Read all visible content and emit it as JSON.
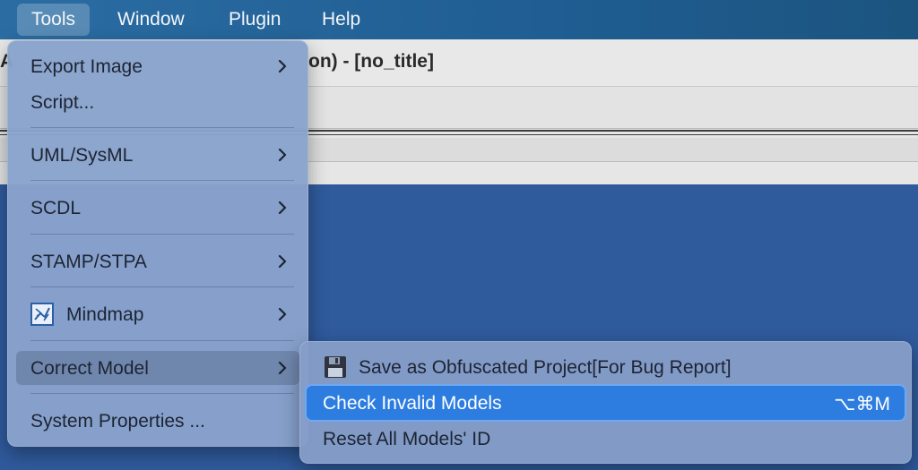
{
  "menubar": {
    "items": [
      {
        "label": "Tools"
      },
      {
        "label": "Window"
      },
      {
        "label": "Plugin"
      },
      {
        "label": "Help"
      }
    ]
  },
  "window": {
    "title_visible": "on) - [no_title]",
    "title_left_fragment": "A"
  },
  "tools_menu": {
    "items": [
      {
        "label": "Export Image",
        "has_submenu": true
      },
      {
        "label": "Script...",
        "has_submenu": false
      },
      {
        "label": "UML/SysML",
        "has_submenu": true
      },
      {
        "label": "SCDL",
        "has_submenu": true
      },
      {
        "label": "STAMP/STPA",
        "has_submenu": true
      },
      {
        "label": "Mindmap",
        "has_submenu": true,
        "icon": "mindmap-icon"
      },
      {
        "label": "Correct Model",
        "has_submenu": true,
        "highlighted": true
      },
      {
        "label": "System Properties ...",
        "has_submenu": false
      }
    ]
  },
  "correct_model_submenu": {
    "items": [
      {
        "label": "Save as Obfuscated Project[For Bug Report]",
        "icon": "floppy-disk-icon"
      },
      {
        "label": "Check Invalid Models",
        "shortcut": "⌥⌘M",
        "selected": true
      },
      {
        "label": "Reset All Models' ID"
      }
    ]
  },
  "colors": {
    "menubar": "#1f5d92",
    "menu_bg": "#89a3cd",
    "selection": "#2d7de0",
    "canvas": "#2f5a9c"
  }
}
